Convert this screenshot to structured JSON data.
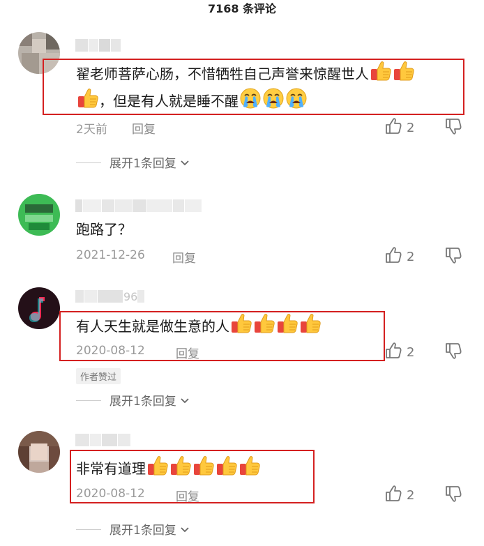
{
  "header": {
    "title": "7168 条评论"
  },
  "comments": [
    {
      "username": "",
      "line1": "翟老师菩萨心肠，不惜牺牲自己声誉来惊醒世人",
      "line2": "，但是有人就是睡不醒",
      "time": "2天前",
      "reply_label": "回复",
      "likes": "2",
      "expand_label": "展开1条回复",
      "emoji_line1": [
        "thumbs-up",
        "thumbs-up"
      ],
      "emoji_line2_lead": [
        "thumbs-up"
      ],
      "emoji_line2_trail": [
        "crying-face",
        "crying-face",
        "crying-face"
      ]
    },
    {
      "username": "",
      "line1": "跑路了？",
      "time": "2021-12-26",
      "reply_label": "回复",
      "likes": "2"
    },
    {
      "username": "96",
      "line1": "有人天生就是做生意的人",
      "time": "2020-08-12",
      "reply_label": "回复",
      "likes": "2",
      "badge": "作者赞过",
      "expand_label": "展开1条回复",
      "emoji_count": 4
    },
    {
      "username": "",
      "line1": "非常有道理",
      "time": "2020-08-12",
      "reply_label": "回复",
      "likes": "2",
      "expand_label": "展开1条回复",
      "emoji_count": 5
    }
  ],
  "colors": {
    "highlight_box": "#d42020",
    "meta_text": "#9a9a9a",
    "body_text": "#1a1a1a"
  },
  "icons": [
    "thumbs-up-outline-icon",
    "thumbs-down-outline-icon",
    "chevron-down-icon",
    "thumbs-up-emoji",
    "crying-face-emoji"
  ]
}
